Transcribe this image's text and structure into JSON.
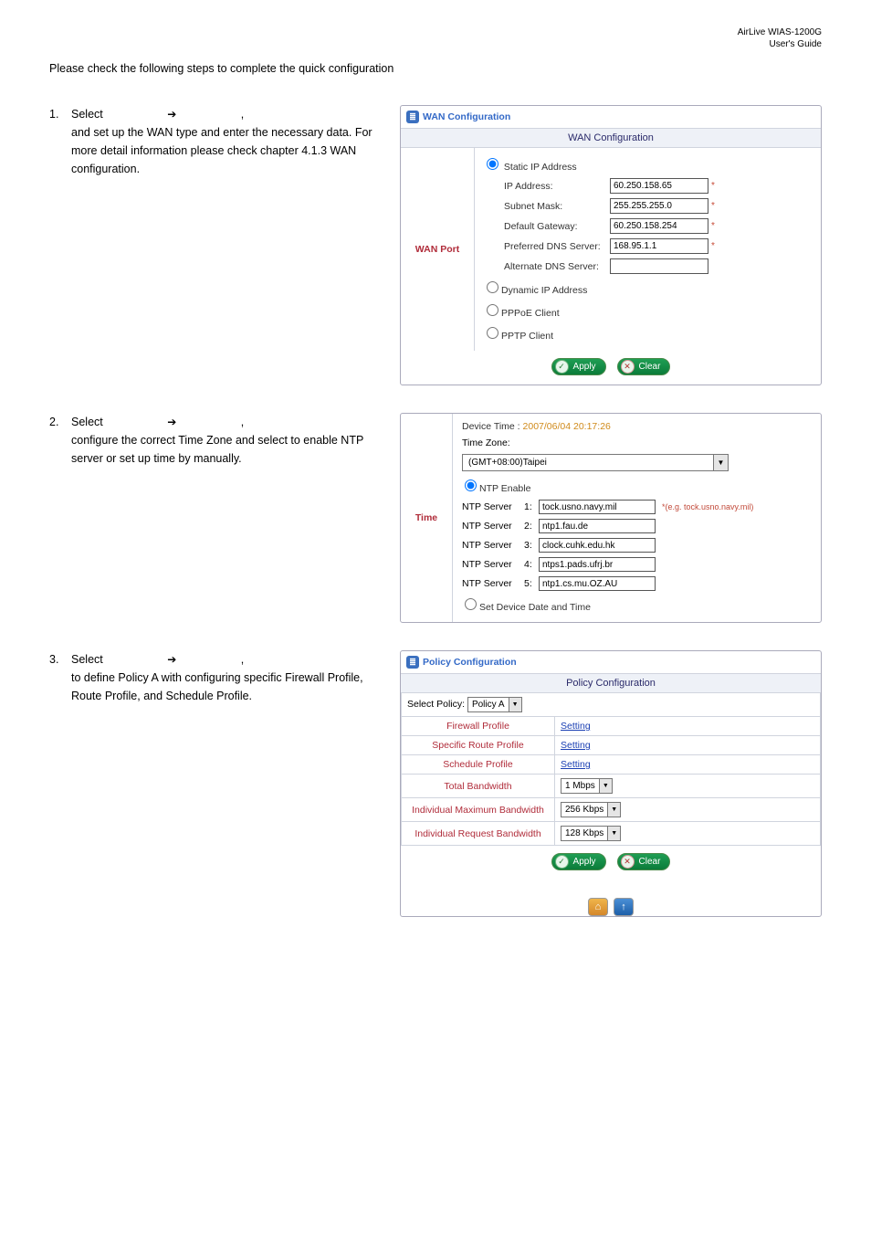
{
  "header": {
    "product": "AirLive  WIAS-1200G",
    "doc": "User's  Guide"
  },
  "intro": "Please check the following steps to complete the quick configuration",
  "step1": {
    "num": "1.",
    "pre": "Select",
    "post": ",",
    "body": "and set up the WAN type and enter the necessary data. For more detail information please check chapter 4.1.3 WAN configuration."
  },
  "step2": {
    "num": "2.",
    "pre": "Select",
    "post": ",",
    "body": "configure the correct Time Zone and select to enable NTP server or set up time by manually."
  },
  "step3": {
    "num": "3.",
    "pre": "Select",
    "post": ",",
    "body": "to define Policy A with configuring specific Firewall Profile, Route Profile, and Schedule Profile."
  },
  "wan": {
    "title": "WAN Configuration",
    "subtitle": "WAN Configuration",
    "port": "WAN Port",
    "radio_static": "Static IP Address",
    "ip_label": "IP Address:",
    "ip_val": "60.250.158.65",
    "mask_label": "Subnet Mask:",
    "mask_val": "255.255.255.0",
    "gw_label": "Default Gateway:",
    "gw_val": "60.250.158.254",
    "pdns_label": "Preferred DNS Server:",
    "pdns_val": "168.95.1.1",
    "adns_label": "Alternate DNS Server:",
    "adns_val": "",
    "radio_dyn": "Dynamic IP Address",
    "radio_pppoe": "PPPoE Client",
    "radio_pptp": "PPTP Client",
    "apply": "Apply",
    "clear": "Clear",
    "star": "*"
  },
  "time": {
    "label": "Time",
    "device_time_label": "Device Time :",
    "device_time_val": "2007/06/04 20:17:26",
    "tz_label": "Time Zone:",
    "tz_val": "(GMT+08:00)Taipei",
    "ntp_enable": "NTP Enable",
    "servers": [
      {
        "label": "NTP Server",
        "idx": "1:",
        "val": "tock.usno.navy.mil",
        "eg": "*(e.g. tock.usno.navy.mil)"
      },
      {
        "label": "NTP Server",
        "idx": "2:",
        "val": "ntp1.fau.de"
      },
      {
        "label": "NTP Server",
        "idx": "3:",
        "val": "clock.cuhk.edu.hk"
      },
      {
        "label": "NTP Server",
        "idx": "4:",
        "val": "ntps1.pads.ufrj.br"
      },
      {
        "label": "NTP Server",
        "idx": "5:",
        "val": "ntp1.cs.mu.OZ.AU"
      }
    ],
    "set_manual": "Set Device Date and Time"
  },
  "policy": {
    "title": "Policy Configuration",
    "subtitle": "Policy Configuration",
    "select_label": "Select Policy:",
    "select_val": "Policy A",
    "rows": [
      {
        "lab": "Firewall Profile",
        "link": "Setting"
      },
      {
        "lab": "Specific Route Profile",
        "link": "Setting"
      },
      {
        "lab": "Schedule Profile",
        "link": "Setting"
      },
      {
        "lab": "Total Bandwidth",
        "sel": "1 Mbps"
      },
      {
        "lab": "Individual Maximum Bandwidth",
        "sel": "256 Kbps"
      },
      {
        "lab": "Individual Request Bandwidth",
        "sel": "128 Kbps"
      }
    ],
    "apply": "Apply",
    "clear": "Clear"
  }
}
